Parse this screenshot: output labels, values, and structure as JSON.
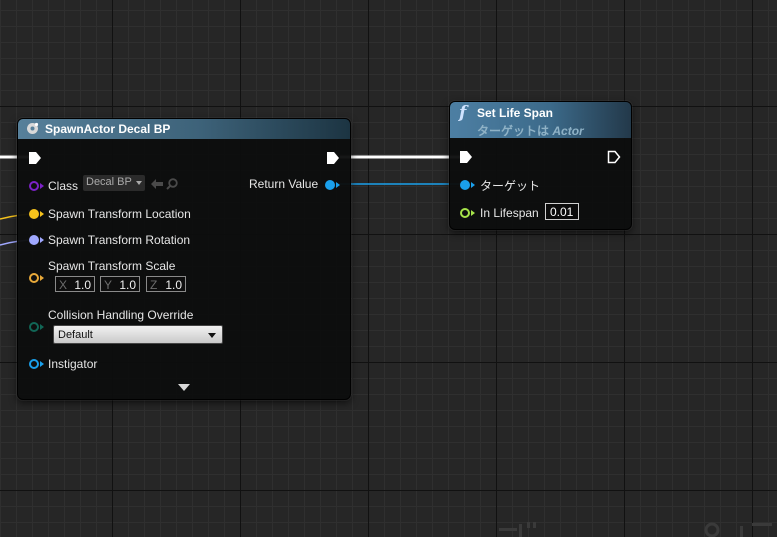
{
  "spawn_node": {
    "title": "SpawnActor Decal BP",
    "class_label": "Class",
    "class_value": "Decal BP",
    "return_value_label": "Return Value",
    "pins": {
      "location": "Spawn Transform Location",
      "rotation": "Spawn Transform Rotation",
      "scale": "Spawn Transform Scale",
      "collision": "Collision Handling Override",
      "instigator": "Instigator"
    },
    "scale": {
      "x_label": "X",
      "x_value": "1.0",
      "y_label": "Y",
      "y_value": "1.0",
      "z_label": "Z",
      "z_value": "1.0"
    },
    "collision_value": "Default"
  },
  "lifespan_node": {
    "fn_icon": "f",
    "title": "Set Life Span",
    "subtitle_prefix": "ターゲットは",
    "subtitle_target": "Actor",
    "target_label": "ターゲット",
    "lifespan_label": "In Lifespan",
    "lifespan_value": "0.01"
  },
  "colors": {
    "exec": "#ffffff",
    "object_ref": "#1aa0ec",
    "class_ref": "#7c22c7",
    "vector": "#f5c21c",
    "rotator": "#a0a8ff",
    "transform": "#e8a93a",
    "float": "#a6e34a",
    "enum": "#116656",
    "instigator": "#1aa0ec"
  }
}
